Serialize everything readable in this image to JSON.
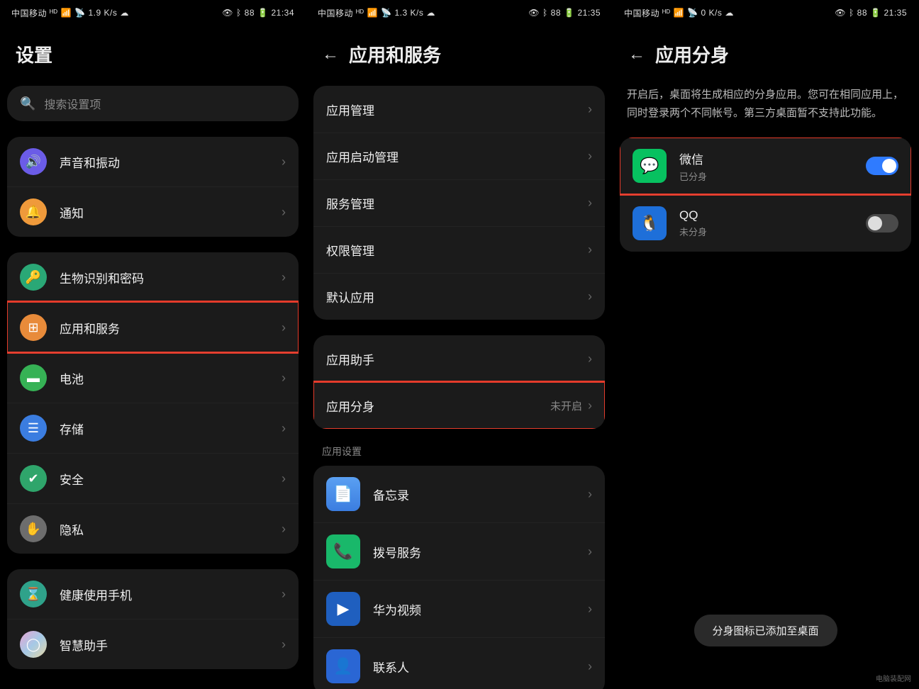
{
  "phones": [
    {
      "status": {
        "carrier": "中国移动",
        "net": "1.9 K/s",
        "battery": "88",
        "time": "21:34"
      },
      "title": "设置",
      "search_placeholder": "搜索设置项",
      "groups": [
        {
          "rows": [
            {
              "icon": "volume-icon",
              "color": "c-purple",
              "glyph": "🔊",
              "label": "声音和振动"
            },
            {
              "icon": "bell-icon",
              "color": "c-orange",
              "glyph": "🔔",
              "label": "通知"
            }
          ]
        },
        {
          "rows": [
            {
              "icon": "key-icon",
              "color": "c-teal",
              "glyph": "🔑",
              "label": "生物识别和密码"
            },
            {
              "icon": "apps-icon",
              "color": "c-orange2",
              "glyph": "⊞",
              "label": "应用和服务",
              "highlight": true
            },
            {
              "icon": "battery-icon",
              "color": "c-green",
              "glyph": "▬",
              "label": "电池"
            },
            {
              "icon": "storage-icon",
              "color": "c-blue",
              "glyph": "☰",
              "label": "存储"
            },
            {
              "icon": "shield-icon",
              "color": "c-green2",
              "glyph": "✔",
              "label": "安全"
            },
            {
              "icon": "privacy-icon",
              "color": "c-gray",
              "glyph": "✋",
              "label": "隐私"
            }
          ]
        },
        {
          "rows": [
            {
              "icon": "hourglass-icon",
              "color": "c-teal2",
              "glyph": "⌛",
              "label": "健康使用手机"
            },
            {
              "icon": "assistant-icon",
              "color": "c-grad",
              "glyph": "◯",
              "label": "智慧助手"
            }
          ]
        }
      ]
    },
    {
      "status": {
        "carrier": "中国移动",
        "net": "1.3 K/s",
        "battery": "88",
        "time": "21:35"
      },
      "title": "应用和服务",
      "back": true,
      "groups": [
        {
          "rows": [
            {
              "label": "应用管理"
            },
            {
              "label": "应用启动管理"
            },
            {
              "label": "服务管理"
            },
            {
              "label": "权限管理"
            },
            {
              "label": "默认应用"
            }
          ]
        },
        {
          "rows": [
            {
              "label": "应用助手"
            },
            {
              "label": "应用分身",
              "value": "未开启",
              "highlight": true
            }
          ]
        }
      ],
      "section_header": "应用设置",
      "app_rows": [
        {
          "app": "notes",
          "class": "ai-notes",
          "glyph": "📄",
          "label": "备忘录"
        },
        {
          "app": "dialer",
          "class": "ai-phone",
          "glyph": "📞",
          "label": "拨号服务"
        },
        {
          "app": "video",
          "class": "ai-video",
          "glyph": "▶",
          "label": "华为视频"
        },
        {
          "app": "contacts",
          "class": "ai-contact",
          "glyph": "👤",
          "label": "联系人"
        }
      ]
    },
    {
      "status": {
        "carrier": "中国移动",
        "net": "0 K/s",
        "battery": "88",
        "time": "21:35"
      },
      "title": "应用分身",
      "back": true,
      "description": "开启后，桌面将生成相应的分身应用。您可在相同应用上，同时登录两个不同帐号。第三方桌面暂不支持此功能。",
      "toggle_rows": [
        {
          "app": "wechat",
          "class": "ai-wechat",
          "glyph": "💬",
          "label": "微信",
          "sub": "已分身",
          "on": true,
          "highlight": true
        },
        {
          "app": "qq",
          "class": "ai-qq",
          "glyph": "🐧",
          "label": "QQ",
          "sub": "未分身",
          "on": false
        }
      ],
      "toast": "分身图标已添加至桌面"
    }
  ],
  "watermark": "电脑装配网"
}
